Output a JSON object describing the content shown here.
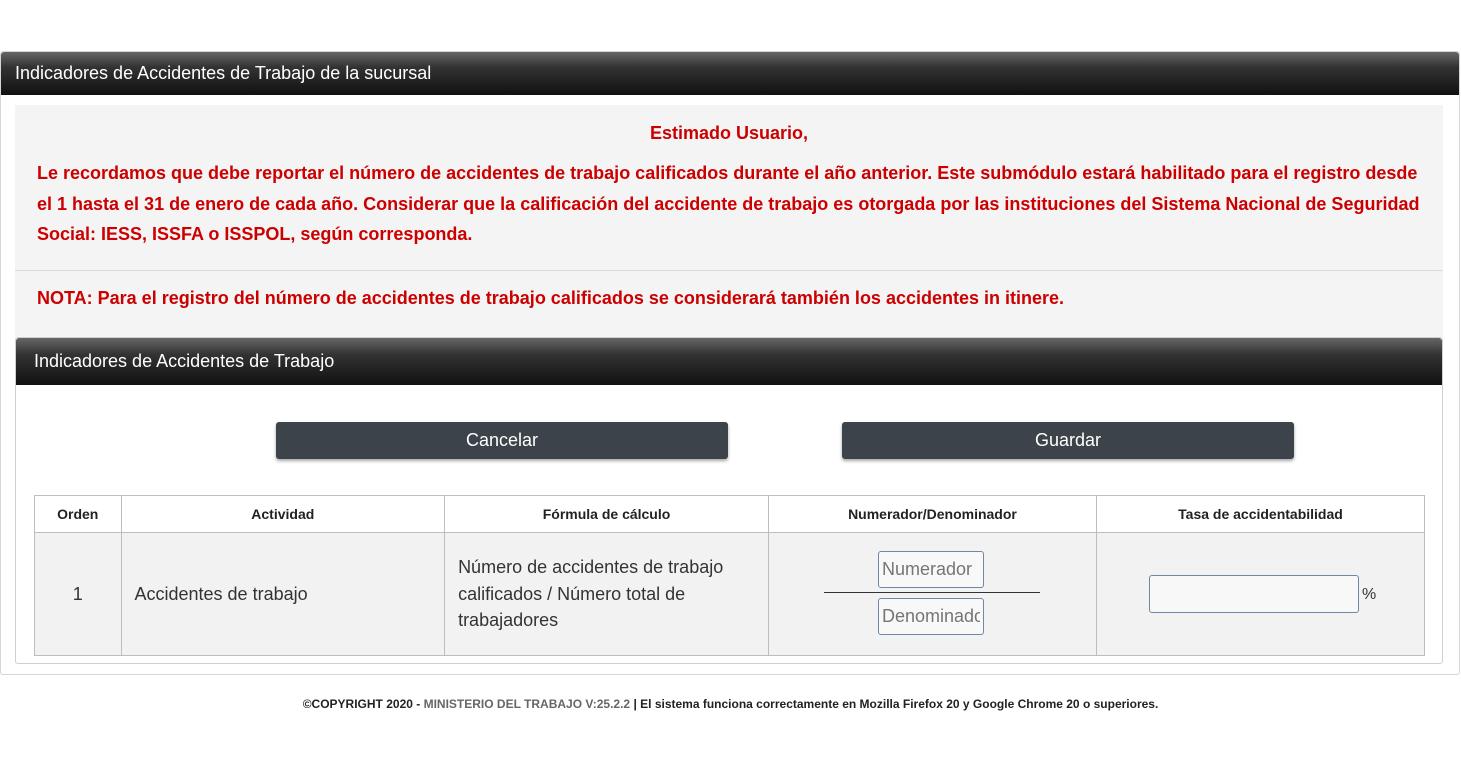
{
  "page": {
    "title": "Indicadores de Accidentes de Trabajo de la sucursal"
  },
  "notice": {
    "greeting": "Estimado Usuario,",
    "message": "Le recordamos que debe reportar el número de accidentes de trabajo calificados durante el año anterior. Este submódulo estará habilitado para el registro desde el 1 hasta el 31 de enero de cada año. Considerar que la calificación del accidente de trabajo es otorgada por las instituciones del Sistema Nacional de Seguridad Social: IESS, ISSFA o ISSPOL, según corresponda.",
    "note": "NOTA: Para el registro del número de accidentes de trabajo calificados se considerará también los accidentes in itinere.",
    "text_color": "#cc0000"
  },
  "section": {
    "title": "Indicadores de Accidentes de Trabajo"
  },
  "buttons": {
    "cancel": "Cancelar",
    "save": "Guardar"
  },
  "table": {
    "headers": [
      "Orden",
      "Actividad",
      "Fórmula de cálculo",
      "Numerador/Denominador",
      "Tasa de accidentabilidad"
    ],
    "rows": [
      {
        "order": "1",
        "activity": "Accidentes de trabajo",
        "formula": "Número de accidentes de trabajo calificados / Número total de trabajadores",
        "numerator_placeholder": "Numerador",
        "denominator_placeholder": "Denominador",
        "rate_value": "",
        "rate_unit": "%"
      }
    ]
  },
  "footer": {
    "copyright": "©COPYRIGHT 2020 -",
    "ministry": "MINISTERIO DEL TRABAJO V:25.2.2",
    "separator": "|",
    "browser_note": "El sistema funciona correctamente en Mozilla Firefox 20 y Google Chrome 20 o superiores."
  }
}
